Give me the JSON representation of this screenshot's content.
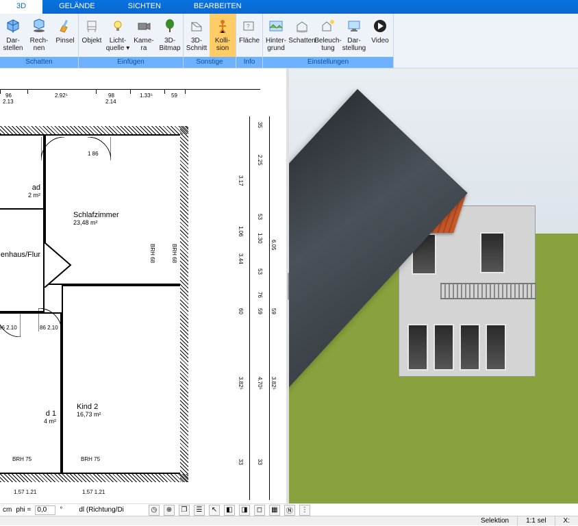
{
  "tabs": {
    "t3d": "3D",
    "gelaende": "GELÄNDE",
    "sichten": "SICHTEN",
    "bearbeiten": "BEARBEITEN"
  },
  "ribbon": {
    "schatten": {
      "label": "Schatten",
      "darstellen": "Dar-\nstellen",
      "rechnen": "Rech-\nnen",
      "pinsel": "Pinsel"
    },
    "einfuegen": {
      "label": "Einfügen",
      "objekt": "Objekt",
      "lichtquelle": "Licht-\nquelle ▾",
      "kamera": "Kame-\nra",
      "bitmap": "3D-\nBitmap"
    },
    "sonstige": {
      "label": "Sonstige",
      "schnitt": "3D-\nSchnitt",
      "kollision": "Kolli-\nsion"
    },
    "info": {
      "label": "Info",
      "flaeche": "Fläche"
    },
    "einstellungen": {
      "label": "Einstellungen",
      "hintergrund": "Hinter-\ngrund",
      "schatten": "Schatten",
      "beleuchtung": "Beleuch-\ntung",
      "darstellung": "Dar-\nstellung",
      "video": "Video"
    }
  },
  "floorplan": {
    "top_dims": {
      "d1a": "96",
      "d1b": "2.13",
      "d2a": "2.92⁵",
      "d3a": "98",
      "d3b": "2.14",
      "d4a": "1.33⁵",
      "d5a": "59"
    },
    "rooms": {
      "bad": {
        "name": "ad",
        "area": "2 m²"
      },
      "flur": {
        "name": "enhaus/Flur"
      },
      "kind1": {
        "name": "d 1",
        "area": "4 m²"
      },
      "kind2": {
        "name": "Kind 2",
        "area": "16,73 m²"
      },
      "schlaf": {
        "name": "Schlafzimmer",
        "area": "23,48 m²"
      }
    },
    "small_dims": {
      "a": "86",
      "b": "2.10",
      "c": "1\n86",
      "d": "86\n2.10",
      "brh75": "BRH 75",
      "brh68": "BRH 68",
      "d157": "1.57\n1.21",
      "d157b": "1.57\n1.21"
    },
    "right_dims": {
      "a": "35",
      "b": "2.25",
      "c": "3.17",
      "d": "53",
      "e": "1.06",
      "f": "1.30",
      "g": "6.05",
      "h": "3.44",
      "i": "53",
      "j": "76",
      "k": "60",
      "l": "59",
      "m": "59",
      "n": "3.82⁵",
      "o": "4.70⁵",
      "p": "3.82⁵",
      "q": "33",
      "r": "33"
    }
  },
  "bottom": {
    "cm": "cm",
    "phi": "phi =",
    "phi_val": "0,0",
    "deg": "°",
    "dl": "dl (Richtung/Di"
  },
  "status": {
    "selektion": "Selektion",
    "scale": "1:1 sel",
    "x": "X:"
  }
}
